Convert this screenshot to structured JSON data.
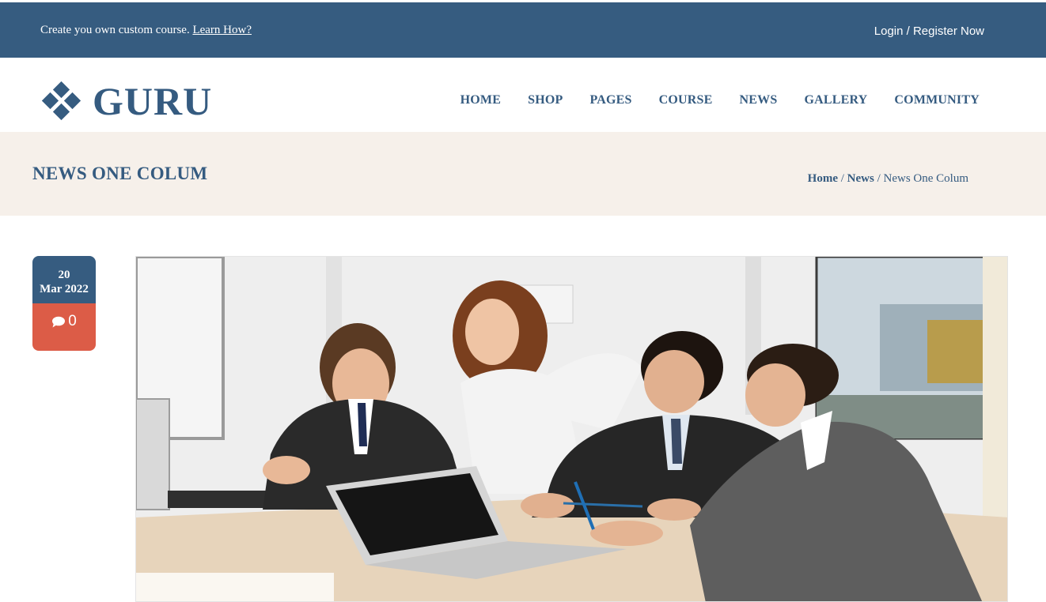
{
  "topbar": {
    "promo_text": "Create you own custom course.",
    "promo_link": "Learn How?",
    "login": "Login / Register Now"
  },
  "header": {
    "logo_text": "GURU",
    "nav": [
      "HOME",
      "SHOP",
      "PAGES",
      "COURSE",
      "NEWS",
      "GALLERY",
      "COMMUNITY"
    ]
  },
  "page_header": {
    "title": "NEWS ONE COLUM",
    "breadcrumb": {
      "home": "Home",
      "sep1": " / ",
      "news": "News",
      "sep2": " / ",
      "current": "News One Colum"
    }
  },
  "post": {
    "day": "20",
    "month_year": "Mar 2022",
    "comments": "0",
    "comment_icon": "comment-icon",
    "image_alt": "Business team meeting around a laptop in an office"
  },
  "colors": {
    "primary": "#365c80",
    "accent": "#dc5c47",
    "page_header_bg": "#f6f0ea"
  }
}
